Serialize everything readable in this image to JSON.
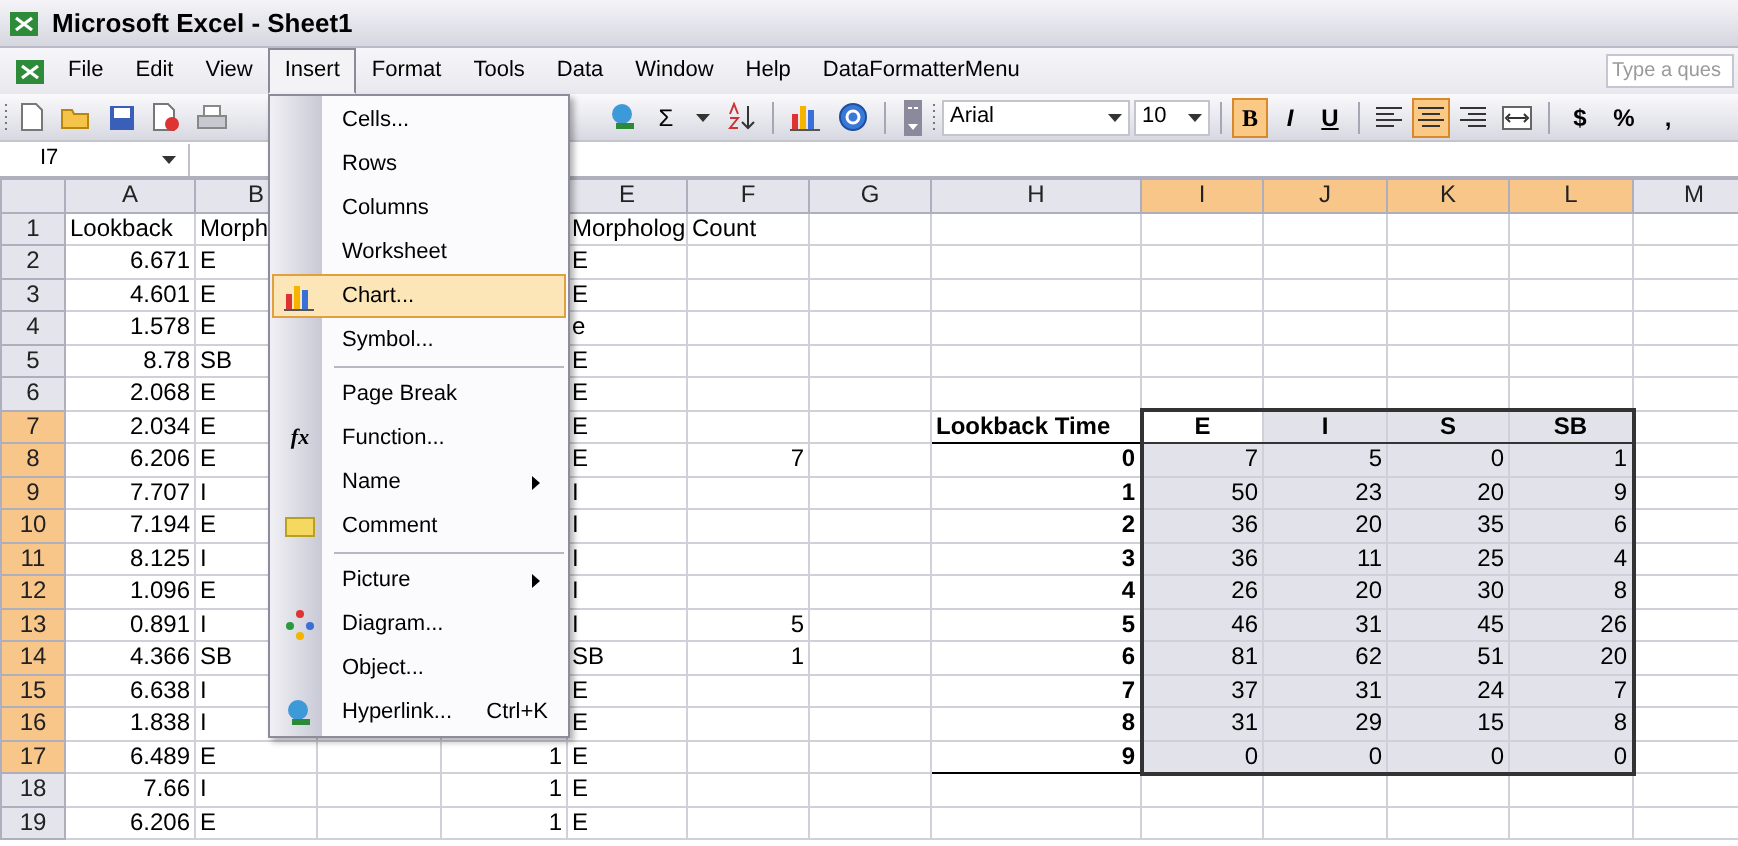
{
  "window": {
    "title": "Microsoft Excel - Sheet1"
  },
  "menubar": {
    "items": [
      {
        "label": "File",
        "selected": false
      },
      {
        "label": "Edit",
        "selected": false
      },
      {
        "label": "View",
        "selected": false
      },
      {
        "label": "Insert",
        "selected": true
      },
      {
        "label": "Format",
        "selected": false
      },
      {
        "label": "Tools",
        "selected": false
      },
      {
        "label": "Data",
        "selected": false
      },
      {
        "label": "Window",
        "selected": false
      },
      {
        "label": "Help",
        "selected": false
      },
      {
        "label": "DataFormatterMenu",
        "selected": false
      }
    ],
    "help_box": {
      "placeholder": "Type a ques"
    }
  },
  "standard_toolbar": {
    "sum_symbol": "Σ"
  },
  "formatting_toolbar": {
    "font": "Arial",
    "size": "10",
    "style_buttons": [
      {
        "text": "B",
        "selected": true
      },
      {
        "text": "I",
        "selected": false
      },
      {
        "text": "U",
        "selected": false
      }
    ],
    "align_buttons": [
      {
        "selected": false
      },
      {
        "selected": true
      },
      {
        "selected": false
      }
    ],
    "number_buttons": [
      "$",
      "%",
      ","
    ]
  },
  "name_box": {
    "value": "I7"
  },
  "insert_menu": [
    {
      "kind": "item",
      "label": "Cells...",
      "selected": false
    },
    {
      "kind": "item",
      "label": "Rows",
      "selected": false
    },
    {
      "kind": "item",
      "label": "Columns",
      "selected": false
    },
    {
      "kind": "item",
      "label": "Worksheet",
      "selected": false
    },
    {
      "kind": "item",
      "label": "Chart...",
      "selected": true
    },
    {
      "kind": "item",
      "label": "Symbol...",
      "selected": false
    },
    {
      "kind": "separator"
    },
    {
      "kind": "item",
      "label": "Page Break",
      "selected": false
    },
    {
      "kind": "item",
      "label": "Function...",
      "selected": false,
      "icon_text": "fx"
    },
    {
      "kind": "item",
      "label": "Name",
      "selected": false,
      "submenu": true
    },
    {
      "kind": "item",
      "label": "Comment",
      "selected": false
    },
    {
      "kind": "separator"
    },
    {
      "kind": "item",
      "label": "Picture",
      "selected": false,
      "submenu": true
    },
    {
      "kind": "item",
      "label": "Diagram...",
      "selected": false
    },
    {
      "kind": "item",
      "label": "Object...",
      "selected": false
    },
    {
      "kind": "item",
      "label": "Hyperlink...",
      "selected": false,
      "shortcut": "Ctrl+K"
    }
  ],
  "sheet": {
    "columns": [
      {
        "label": "A",
        "selected": false
      },
      {
        "label": "B",
        "selected": false
      },
      {
        "label": "E",
        "selected": false
      },
      {
        "label": "F",
        "selected": false
      },
      {
        "label": "G",
        "selected": false
      },
      {
        "label": "H",
        "selected": false
      },
      {
        "label": "I",
        "selected": true
      },
      {
        "label": "J",
        "selected": true
      },
      {
        "label": "K",
        "selected": true
      },
      {
        "label": "L",
        "selected": true
      },
      {
        "label": "M",
        "selected": false
      }
    ],
    "rows": [
      {
        "header": "1",
        "selected": false,
        "cells": {
          "A": "Lookback",
          "B": "Morph",
          "E": "Morpholog",
          "F": "Count"
        }
      },
      {
        "header": "2",
        "selected": false,
        "cells": {
          "A": "6.671",
          "B": "E",
          "E": "E"
        }
      },
      {
        "header": "3",
        "selected": false,
        "cells": {
          "A": "4.601",
          "B": "E",
          "E": "E"
        }
      },
      {
        "header": "4",
        "selected": false,
        "cells": {
          "A": "1.578",
          "B": "E",
          "E": "e"
        }
      },
      {
        "header": "5",
        "selected": false,
        "cells": {
          "A": "8.78",
          "B": "SB",
          "E": "E"
        }
      },
      {
        "header": "6",
        "selected": false,
        "cells": {
          "A": "2.068",
          "B": "E",
          "E": "E"
        }
      },
      {
        "header": "7",
        "selected": true,
        "cells": {
          "A": "2.034",
          "B": "E",
          "E": "E",
          "H": {
            "text": "Lookback Time",
            "bold": true
          },
          "I": {
            "text": "E",
            "bold": true
          },
          "J": {
            "text": "I",
            "bold": true
          },
          "K": {
            "text": "S",
            "bold": true
          },
          "L": {
            "text": "SB",
            "bold": true
          }
        }
      },
      {
        "header": "8",
        "selected": true,
        "cells": {
          "A": "6.206",
          "B": "E",
          "E": "E",
          "F": "7",
          "H": {
            "text": "0",
            "bold": true
          },
          "I": "7",
          "J": "5",
          "K": "0",
          "L": "1"
        }
      },
      {
        "header": "9",
        "selected": true,
        "cells": {
          "A": "7.707",
          "B": "I",
          "E": "I",
          "H": {
            "text": "1",
            "bold": true
          },
          "I": "50",
          "J": "23",
          "K": "20",
          "L": "9"
        }
      },
      {
        "header": "10",
        "selected": true,
        "cells": {
          "A": "7.194",
          "B": "E",
          "E": "I",
          "H": {
            "text": "2",
            "bold": true
          },
          "I": "36",
          "J": "20",
          "K": "35",
          "L": "6"
        }
      },
      {
        "header": "11",
        "selected": true,
        "cells": {
          "A": "8.125",
          "B": "I",
          "E": "I",
          "H": {
            "text": "3",
            "bold": true
          },
          "I": "36",
          "J": "11",
          "K": "25",
          "L": "4"
        }
      },
      {
        "header": "12",
        "selected": true,
        "cells": {
          "A": "1.096",
          "B": "E",
          "E": "I",
          "H": {
            "text": "4",
            "bold": true
          },
          "I": "26",
          "J": "20",
          "K": "30",
          "L": "8"
        }
      },
      {
        "header": "13",
        "selected": true,
        "cells": {
          "A": "0.891",
          "B": "I",
          "E": "I",
          "F": "5",
          "H": {
            "text": "5",
            "bold": true
          },
          "I": "46",
          "J": "31",
          "K": "45",
          "L": "26"
        }
      },
      {
        "header": "14",
        "selected": true,
        "cells": {
          "A": "4.366",
          "B": "SB",
          "E": "SB",
          "F": "1",
          "H": {
            "text": "6",
            "bold": true
          },
          "I": "81",
          "J": "62",
          "K": "51",
          "L": "20"
        }
      },
      {
        "header": "15",
        "selected": true,
        "cells": {
          "A": "6.638",
          "B": "I",
          "E": "E",
          "H": {
            "text": "7",
            "bold": true
          },
          "I": "37",
          "J": "31",
          "K": "24",
          "L": "7"
        }
      },
      {
        "header": "16",
        "selected": true,
        "cells": {
          "A": "1.838",
          "B": "I",
          "E": "E",
          "H": {
            "text": "8",
            "bold": true
          },
          "I": "31",
          "J": "29",
          "K": "15",
          "L": "8"
        }
      },
      {
        "header": "17",
        "selected": true,
        "cells": {
          "A": "6.489",
          "B": "E",
          "D": "1",
          "E": "E",
          "H": {
            "text": "9",
            "bold": true
          },
          "I": "0",
          "J": "0",
          "K": "0",
          "L": "0"
        }
      },
      {
        "header": "18",
        "selected": false,
        "cells": {
          "A": "7.66",
          "B": "I",
          "D": "1",
          "E": "E"
        }
      },
      {
        "header": "19",
        "selected": false,
        "cells": {
          "A": "6.206",
          "B": "E",
          "D": "1",
          "E": "E"
        }
      }
    ]
  }
}
